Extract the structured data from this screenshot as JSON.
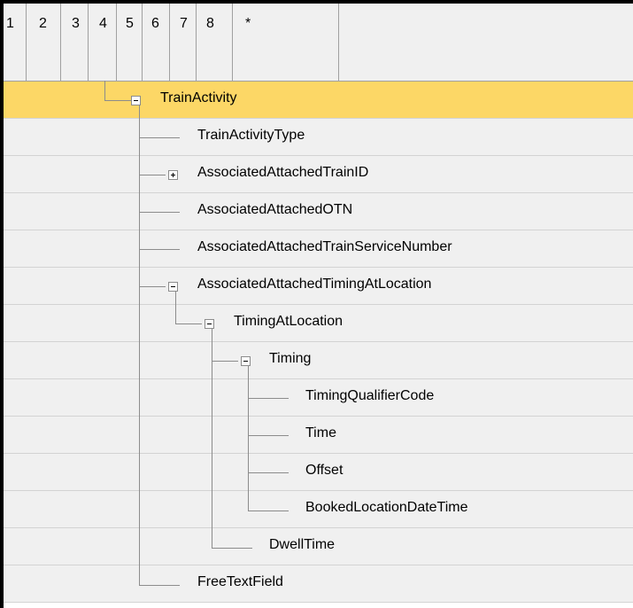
{
  "header": {
    "columns": [
      "1",
      "2",
      "3",
      "4",
      "5",
      "6",
      "7",
      "8",
      "*"
    ]
  },
  "tree": {
    "rows": [
      {
        "label": "TrainActivity",
        "expander": "collapse",
        "selected": true
      },
      {
        "label": "TrainActivityType",
        "expander": "none",
        "selected": false
      },
      {
        "label": "AssociatedAttachedTrainID",
        "expander": "expand",
        "selected": false
      },
      {
        "label": "AssociatedAttachedOTN",
        "expander": "none",
        "selected": false
      },
      {
        "label": "AssociatedAttachedTrainServiceNumber",
        "expander": "none",
        "selected": false
      },
      {
        "label": "AssociatedAttachedTimingAtLocation",
        "expander": "collapse",
        "selected": false
      },
      {
        "label": "TimingAtLocation",
        "expander": "collapse",
        "selected": false
      },
      {
        "label": "Timing",
        "expander": "collapse",
        "selected": false
      },
      {
        "label": "TimingQualifierCode",
        "expander": "none",
        "selected": false
      },
      {
        "label": "Time",
        "expander": "none",
        "selected": false
      },
      {
        "label": "Offset",
        "expander": "none",
        "selected": false
      },
      {
        "label": "BookedLocationDateTime",
        "expander": "none",
        "selected": false
      },
      {
        "label": "DwellTime",
        "expander": "none",
        "selected": false
      },
      {
        "label": "FreeTextField",
        "expander": "none",
        "selected": false
      }
    ]
  },
  "colors": {
    "selected_row": "#fcd766",
    "row_background": "#f0f0f0",
    "tree_line": "#8c8c8c"
  },
  "icons": {
    "collapse": "minus-box-icon",
    "expand": "plus-box-icon"
  }
}
